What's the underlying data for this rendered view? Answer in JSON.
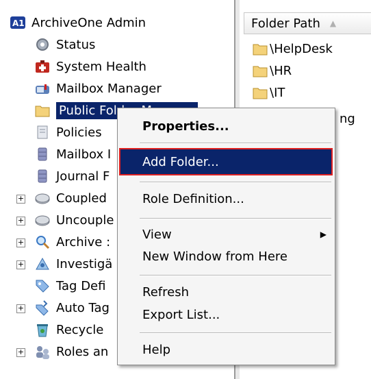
{
  "tree": {
    "root_label": "ArchiveOne Admin",
    "items": [
      {
        "label": "Status"
      },
      {
        "label": "System Health"
      },
      {
        "label": "Mailbox Manager"
      },
      {
        "label": "Public Folder Manager"
      },
      {
        "label": "Policies"
      },
      {
        "label": "Mailbox I"
      },
      {
        "label": "Journal F"
      },
      {
        "label": "Coupled"
      },
      {
        "label": "Uncouple"
      },
      {
        "label": "Archive :"
      },
      {
        "label": "Investigä"
      },
      {
        "label": "Tag Defi"
      },
      {
        "label": "Auto Tag"
      },
      {
        "label": "Recycle"
      },
      {
        "label": "Roles an"
      }
    ]
  },
  "list": {
    "column_header": "Folder Path",
    "items": [
      {
        "label": "\\HelpDesk"
      },
      {
        "label": "\\HR"
      },
      {
        "label": "\\IT"
      },
      {
        "label": "ng"
      }
    ]
  },
  "context_menu": {
    "items": [
      {
        "label": "Properties..."
      },
      {
        "label": "Add Folder..."
      },
      {
        "label": "Role Definition..."
      },
      {
        "label": "View"
      },
      {
        "label": "New Window from Here"
      },
      {
        "label": "Refresh"
      },
      {
        "label": "Export List..."
      },
      {
        "label": "Help"
      }
    ]
  }
}
